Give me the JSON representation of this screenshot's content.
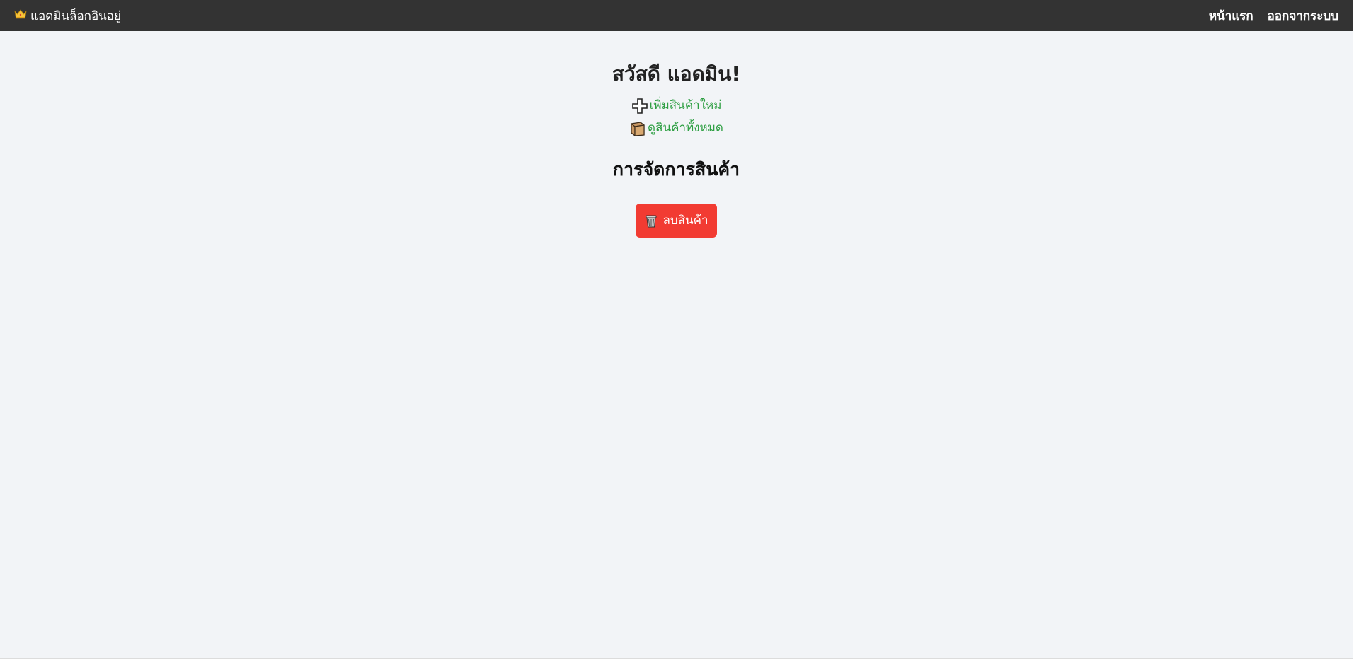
{
  "topbar": {
    "brand_icon": "crown-icon",
    "brand_text": "แอดมินล็อกอินอยู่",
    "nav": {
      "home": "หน้าแรก",
      "logout": "ออกจากระบบ"
    },
    "background": "#333333"
  },
  "main": {
    "greeting": "สวัสดี แอดมิน!",
    "links": {
      "add_product": {
        "label": "เพิ่มสินค้าใหม่",
        "icon": "plus-icon"
      },
      "view_products": {
        "label": "ดูสินค้าทั้งหมด",
        "icon": "box-icon"
      }
    },
    "section_title": "การจัดการสินค้า",
    "delete_button": {
      "label": "ลบสินค้า",
      "icon": "trash-icon"
    }
  },
  "colors": {
    "link": "#2e9f43",
    "danger": "#f23b32",
    "page_background": "#f2f4f7"
  }
}
